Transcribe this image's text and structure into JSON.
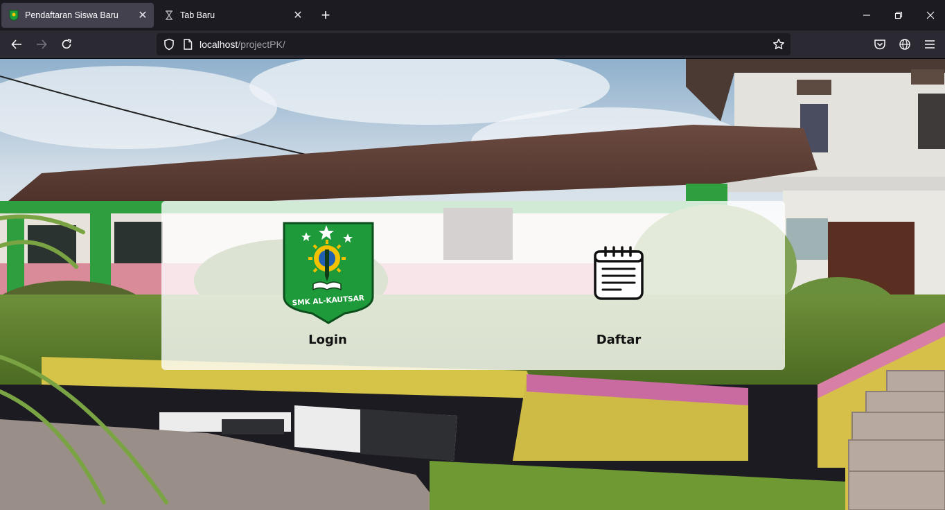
{
  "browser": {
    "tabs": [
      {
        "title": "Pendaftaran Siswa Baru",
        "active": true
      },
      {
        "title": "Tab Baru",
        "active": false
      }
    ],
    "url": {
      "host": "localhost",
      "path": "/projectPK/"
    },
    "colors": {
      "tabstrip": "#1c1b22",
      "toolbar": "#2b2a33",
      "active_tab": "#42414d"
    }
  },
  "page": {
    "logo_text": "SMK AL-KAUTSAR",
    "menu": [
      {
        "label": "Login",
        "icon": "school-logo-icon"
      },
      {
        "label": "Daftar",
        "icon": "notepad-icon"
      }
    ]
  }
}
